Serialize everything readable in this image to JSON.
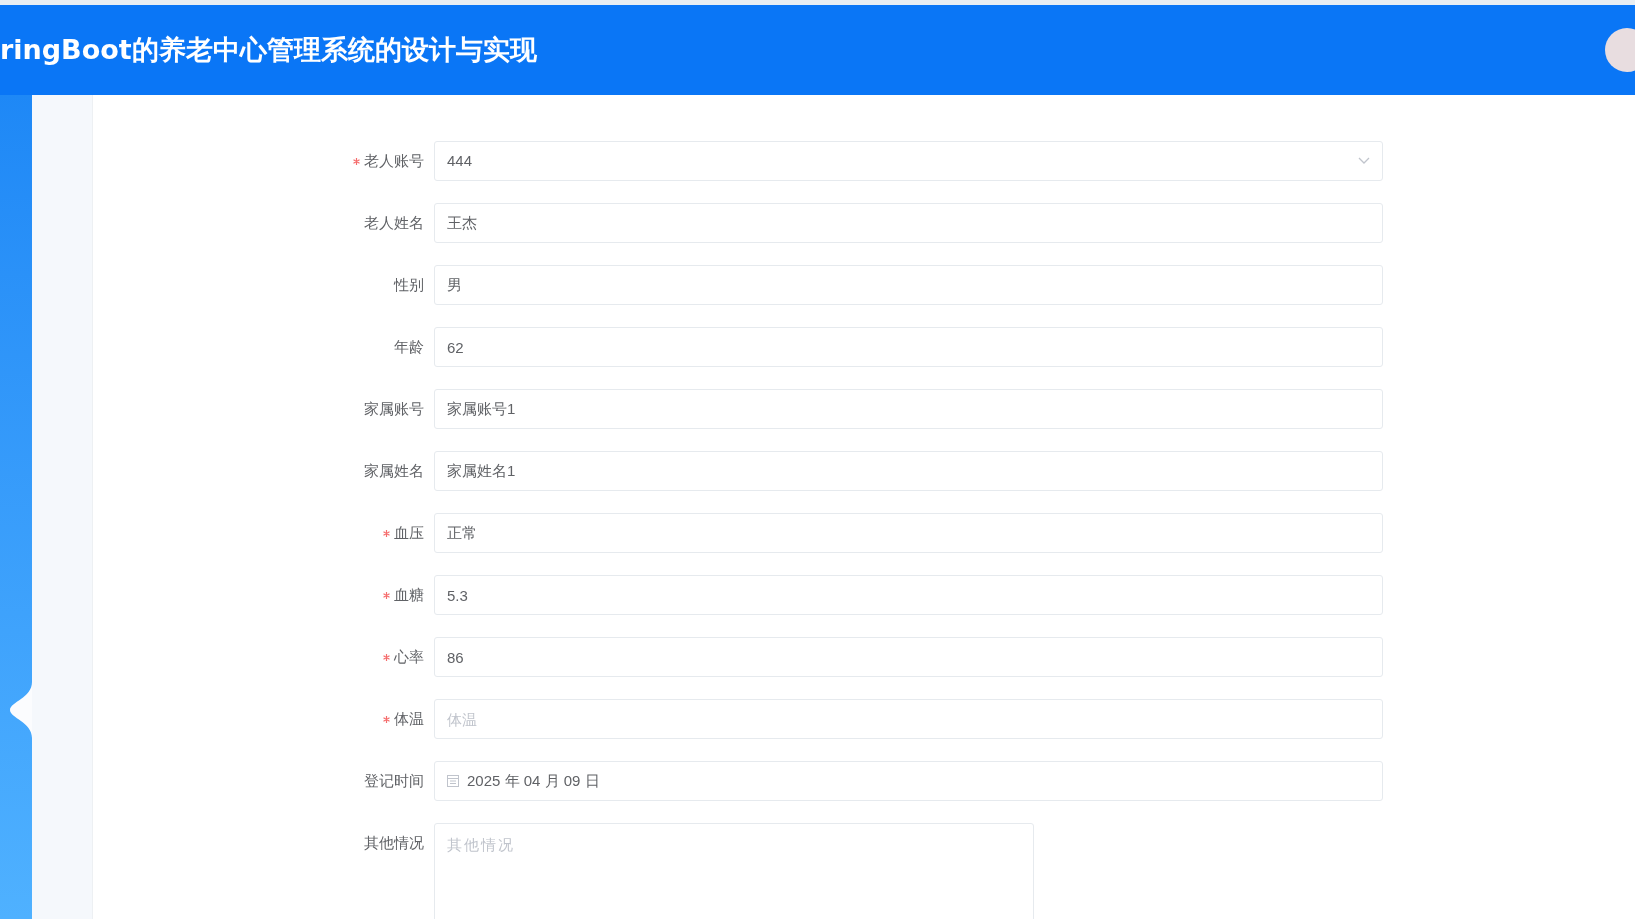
{
  "header": {
    "title": "ringBoot的养老中心管理系统的设计与实现"
  },
  "form": {
    "fields": [
      {
        "kind": "select",
        "label": "老人账号",
        "required": true,
        "value": "444"
      },
      {
        "kind": "input",
        "label": "老人姓名",
        "required": false,
        "value": "王杰"
      },
      {
        "kind": "input",
        "label": "性别",
        "required": false,
        "value": "男"
      },
      {
        "kind": "input",
        "label": "年龄",
        "required": false,
        "value": "62"
      },
      {
        "kind": "input",
        "label": "家属账号",
        "required": false,
        "value": "家属账号1"
      },
      {
        "kind": "input",
        "label": "家属姓名",
        "required": false,
        "value": "家属姓名1"
      },
      {
        "kind": "input",
        "label": "血压",
        "required": true,
        "value": "正常"
      },
      {
        "kind": "input",
        "label": "血糖",
        "required": true,
        "value": "5.3"
      },
      {
        "kind": "input",
        "label": "心率",
        "required": true,
        "value": "86"
      },
      {
        "kind": "input",
        "label": "体温",
        "required": true,
        "placeholder": "体温"
      },
      {
        "kind": "date",
        "label": "登记时间",
        "required": false,
        "value": "2025 年 04 月 09 日"
      },
      {
        "kind": "textarea",
        "label": "其他情况",
        "required": false,
        "placeholder": "其他情况"
      }
    ]
  }
}
